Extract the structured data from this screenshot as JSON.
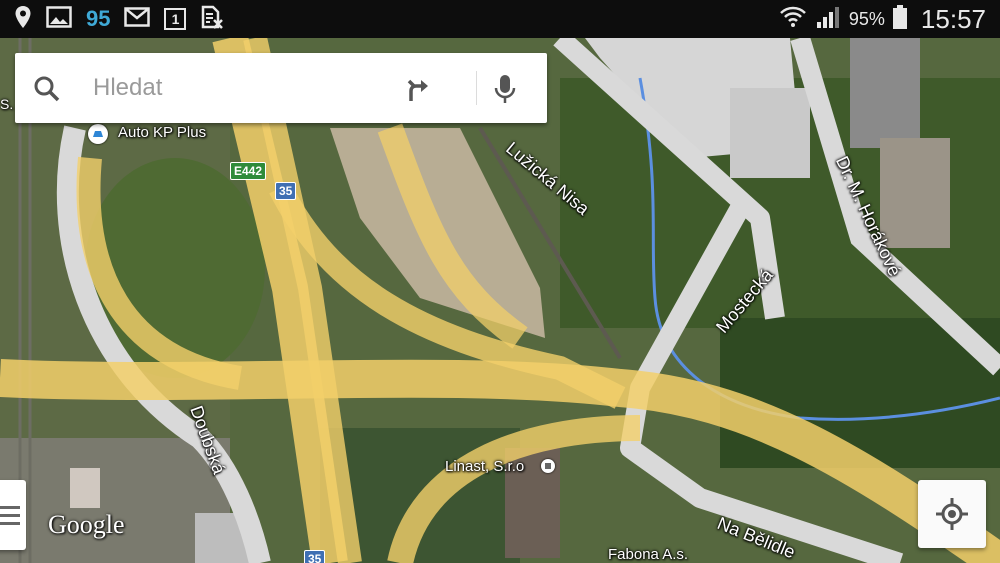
{
  "status_bar": {
    "notification_count": "95",
    "calendar_day": "1",
    "battery_percent": "95%",
    "time": "15:57",
    "icons": [
      "location-icon",
      "gallery-icon",
      "gmail-icon",
      "calendar-icon",
      "no-sim-icon",
      "wifi-icon",
      "signal-icon",
      "battery-icon"
    ]
  },
  "search": {
    "placeholder": "Hledat",
    "icons": [
      "search-icon",
      "directions-icon",
      "microphone-icon"
    ]
  },
  "map": {
    "places": {
      "auto_kp": "Auto KP Plus",
      "linast": "Linast, S.r.o",
      "fabona": "Fabona A.s."
    },
    "streets": {
      "luzicka": "Lužická Nisa",
      "horakove": "Dr. M. Horákové",
      "mostecka": "Mostecká",
      "doubska": "Doubská",
      "na_belidle": "Na Bělidle",
      "left_edge": "S."
    },
    "shields": {
      "e442": "E442",
      "r35_top": "35",
      "r35_bottom": "35"
    },
    "attribution": "Google",
    "colors": {
      "road": "#f2cf6a",
      "minor_road": "#d9d9d9",
      "river": "#5b8fe0",
      "shield_green": "#2e8b3a",
      "shield_blue": "#3f6fb3"
    }
  },
  "controls": {
    "menu": "menu-icon",
    "locate": "my-location-icon"
  }
}
